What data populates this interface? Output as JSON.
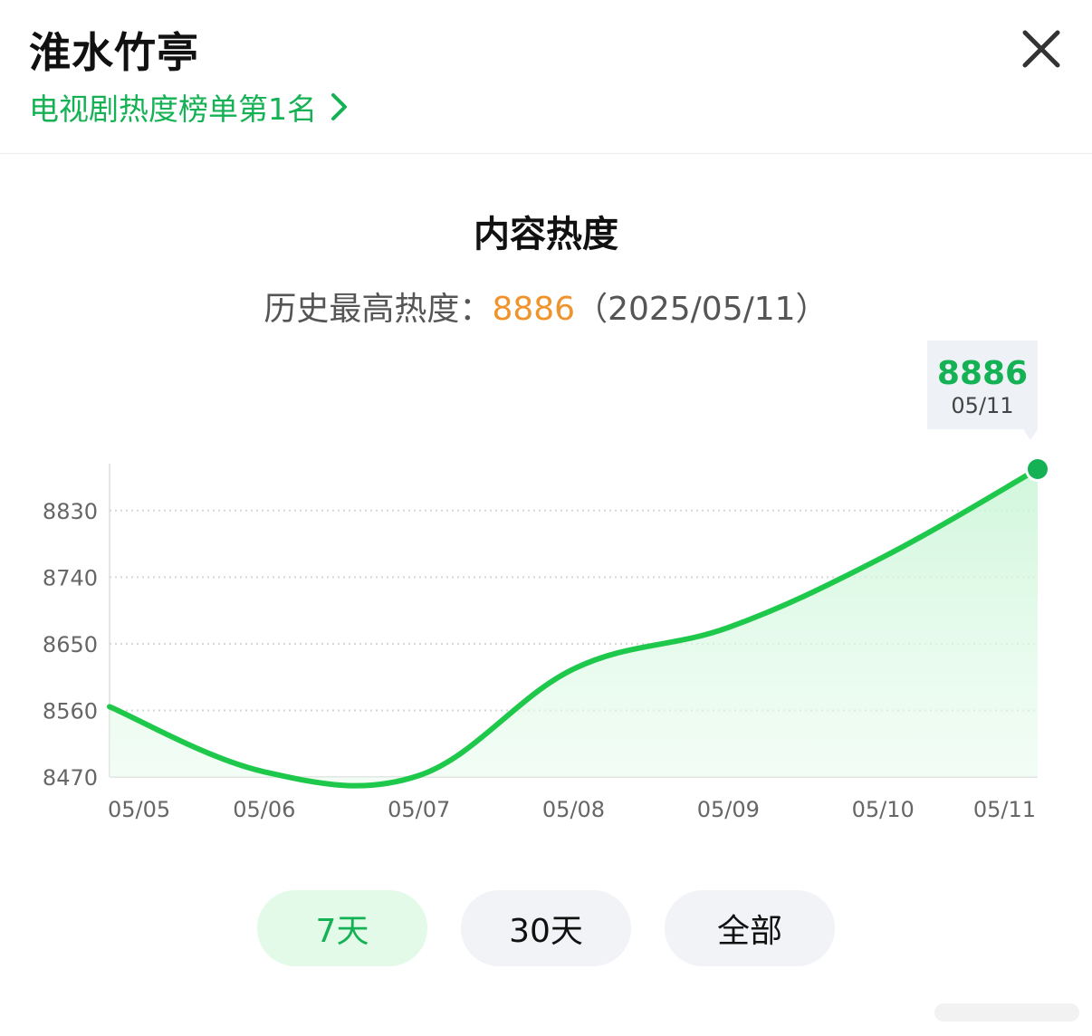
{
  "header": {
    "title": "淮水竹亭",
    "rank_link": "电视剧热度榜单第1名"
  },
  "chart_title": "内容热度",
  "peak": {
    "label": "历史最高热度：",
    "value": "8886",
    "date": "（2025/05/11）"
  },
  "tooltip": {
    "value": "8886",
    "date": "05/11"
  },
  "tabs": [
    {
      "label": "7天",
      "active": true
    },
    {
      "label": "30天",
      "active": false
    },
    {
      "label": "全部",
      "active": false
    }
  ],
  "colors": {
    "accent": "#15b255",
    "line": "#1ec84a",
    "peak": "#f0932b"
  },
  "chart_data": {
    "type": "area",
    "title": "内容热度",
    "x": [
      "05/05",
      "05/06",
      "05/07",
      "05/08",
      "05/09",
      "05/10",
      "05/11"
    ],
    "series": [
      {
        "values": [
          8565,
          8477,
          8472,
          8616,
          8672,
          8767,
          8886
        ]
      }
    ],
    "yticks": [
      8830,
      8740,
      8650,
      8560,
      8470
    ],
    "ylim": [
      8470,
      8886
    ],
    "grid": "horizontal dotted",
    "highlight": {
      "x": "05/11",
      "y": 8886
    }
  }
}
